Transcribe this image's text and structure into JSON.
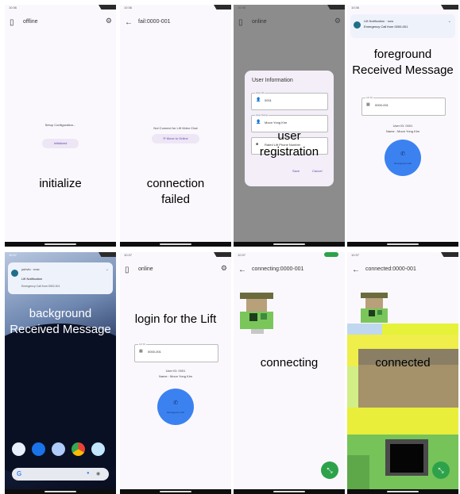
{
  "panels": {
    "p1": {
      "title": "offline",
      "status": "Setup Configuration...",
      "button": "Initialized",
      "caption_lines": [
        "initialize"
      ]
    },
    "p2": {
      "title": "fail:0000-001",
      "status": "Not Connect for Lift Video Chat",
      "button": "Move to Online",
      "caption_lines": [
        "connection",
        "failed"
      ]
    },
    "p3": {
      "title": "online",
      "dialog_title": "User Information",
      "fields": [
        {
          "label": "User ID",
          "value": "0001"
        },
        {
          "label": "User Name",
          "value": "Moon Yong Kim"
        },
        {
          "label": "",
          "value": "Rated Lift Phone Number"
        }
      ],
      "actions": [
        "Save",
        "Cancel"
      ],
      "caption_lines": [
        "user",
        "registration"
      ]
    },
    "p4": {
      "notif_app": "Lift Notification · now",
      "notif_body": "Emergency Call from 0000-001",
      "field_label": "Lift ID",
      "field_value": "0000-001",
      "user_id": "User ID: 0001",
      "user_name": "Name : Moon Yong Kim",
      "call_label": "Emergency Call",
      "caption_lines": [
        "foreground",
        "Received Message"
      ]
    },
    "p5": {
      "notif_app": "yuhvlo · now",
      "notif_title": "Lift Notification",
      "notif_body": "Emergency Call from 0000-001",
      "search_logo": "G",
      "caption_lines": [
        "background",
        "Received Message"
      ]
    },
    "p6": {
      "title": "online",
      "field_label": "Lift ID",
      "field_value": "0000-001",
      "user_id": "User ID: 0001",
      "user_name": "Name : Moon Yong Kim",
      "call_label": "Emergency Call",
      "caption_lines": [
        "login for the Lift"
      ]
    },
    "p7": {
      "title": "connecting:0000-001",
      "caption_lines": [
        "connecting"
      ]
    },
    "p8": {
      "title": "connected:0000-001",
      "caption_lines": [
        "connected"
      ]
    }
  },
  "colors": {
    "accent": "#6a3fb5",
    "call_button": "#3b82f0",
    "end_call": "#2da24a",
    "dim_overlay": "#8c8c8c"
  }
}
